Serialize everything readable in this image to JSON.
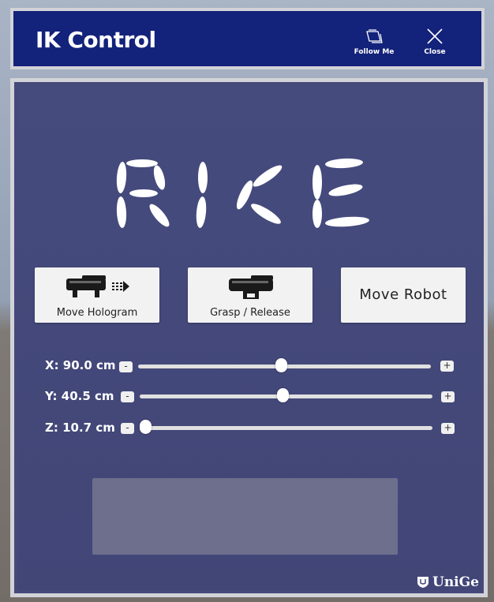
{
  "header": {
    "title": "IK Control",
    "follow_label": "Follow Me",
    "close_label": "Close"
  },
  "logo": {
    "text": "RICE"
  },
  "buttons": {
    "move_hologram": "Move Hologram",
    "grasp_release": "Grasp / Release",
    "move_robot": "Move Robot"
  },
  "sliders": [
    {
      "label": "X: 90.0 cm",
      "position": 0.49,
      "minus": "-",
      "plus": "+"
    },
    {
      "label": "Y: 40.5 cm",
      "position": 0.49,
      "minus": "-",
      "plus": "+"
    },
    {
      "label": "Z: 10.7 cm",
      "position": 0.0,
      "minus": "-",
      "plus": "+"
    }
  ],
  "output": {
    "text": ""
  },
  "brand": {
    "text": "UniGe"
  },
  "colors": {
    "header_bg": "#13227a",
    "panel_bg": "#45497a",
    "frame": "#d2d3d8"
  }
}
